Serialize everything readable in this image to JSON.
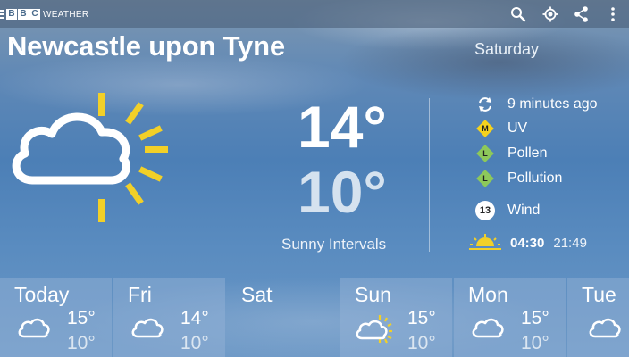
{
  "topbar": {
    "brand_letters": [
      "B",
      "B",
      "C"
    ],
    "brand_word": "WEATHER",
    "icons": [
      "search-icon",
      "location-icon",
      "share-icon",
      "overflow-menu-icon"
    ]
  },
  "location": {
    "name": "Newcastle upon Tyne"
  },
  "selected_day": "Saturday",
  "current": {
    "high": "14°",
    "low": "10°",
    "condition": "Sunny Intervals",
    "icon": "sunny-intervals-icon"
  },
  "details": {
    "updated": "9 minutes ago",
    "uv": {
      "letter": "M",
      "label": "UV",
      "color": "#f5d21c"
    },
    "pollen": {
      "letter": "L",
      "label": "Pollen",
      "color": "#8dc85a"
    },
    "pollution": {
      "letter": "L",
      "label": "Pollution",
      "color": "#8dc85a"
    },
    "wind": {
      "speed": "13",
      "label": "Wind"
    },
    "sunrise": "04:30",
    "sunset": "21:49"
  },
  "forecast": [
    {
      "day": "Today",
      "high": "15°",
      "low": "10°",
      "icon": "cloud-icon"
    },
    {
      "day": "Fri",
      "high": "14°",
      "low": "10°",
      "icon": "cloud-icon"
    },
    {
      "day": "Sat",
      "high": "",
      "low": "",
      "icon": ""
    },
    {
      "day": "Sun",
      "high": "15°",
      "low": "10°",
      "icon": "sunny-intervals-icon"
    },
    {
      "day": "Mon",
      "high": "15°",
      "low": "10°",
      "icon": "cloud-icon"
    },
    {
      "day": "Tue",
      "high": "",
      "low": "",
      "icon": "cloud-icon"
    }
  ],
  "colors": {
    "sun_yellow": "#f2d028",
    "sky_blue": "#4c7fb6"
  }
}
